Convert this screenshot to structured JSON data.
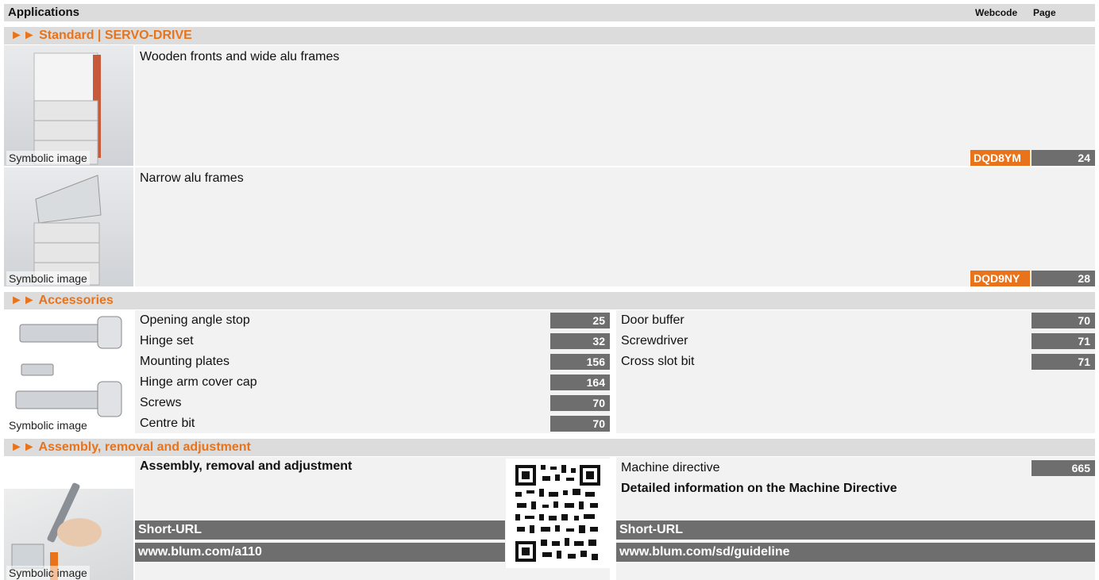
{
  "header": {
    "applications": "Applications",
    "webcode": "Webcode",
    "page": "Page"
  },
  "sections": {
    "standard": "►► Standard | SERVO-DRIVE",
    "accessories": "►► Accessories",
    "assembly": "►► Assembly, removal and adjustment"
  },
  "caption": "Symbolic image",
  "rows": [
    {
      "title": "Wooden fronts and wide alu frames",
      "webcode": "DQD8YM",
      "page": "24"
    },
    {
      "title": "Narrow alu frames",
      "webcode": "DQD9NY",
      "page": "28"
    }
  ],
  "accessories_left": [
    {
      "label": "Opening angle stop",
      "page": "25"
    },
    {
      "label": "Hinge set",
      "page": "32"
    },
    {
      "label": "Mounting plates",
      "page": "156"
    },
    {
      "label": "Hinge arm cover cap",
      "page": "164"
    },
    {
      "label": "Screws",
      "page": "70"
    },
    {
      "label": "Centre bit",
      "page": "70"
    }
  ],
  "accessories_right": [
    {
      "label": "Door buffer",
      "page": "70"
    },
    {
      "label": "Screwdriver",
      "page": "71"
    },
    {
      "label": "Cross slot bit",
      "page": "71"
    }
  ],
  "assembly": {
    "title": "Assembly, removal and adjustment",
    "short_label": "Short-URL",
    "url": "www.blum.com/a110"
  },
  "machine": {
    "label": "Machine directive",
    "page": "665",
    "detail": "Detailed information on the Machine Directive",
    "short_label": "Short-URL",
    "url": "www.blum.com/sd/guideline"
  },
  "colors": {
    "accent": "#e8731a",
    "badge": "#6e6e6e",
    "header_gray": "#dcdcdc"
  }
}
